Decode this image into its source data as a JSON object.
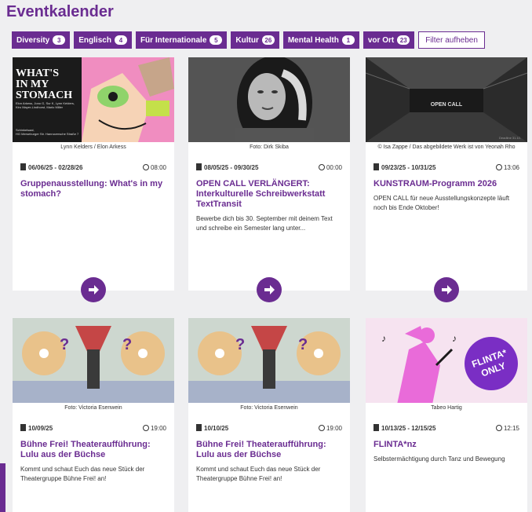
{
  "page": {
    "title": "Eventkalender"
  },
  "filters": [
    {
      "label": "Diversity",
      "count": "3"
    },
    {
      "label": "Englisch",
      "count": "4"
    },
    {
      "label": "Für Internationale",
      "count": "5"
    },
    {
      "label": "Kultur",
      "count": "26"
    },
    {
      "label": "Mental Health",
      "count": "1"
    },
    {
      "label": "vor Ort",
      "count": "23"
    }
  ],
  "reset_label": "Filter aufheben",
  "events": [
    {
      "credit": "Lynn Kelders / Elon Arkess",
      "date": "06/06/25 - 02/28/26",
      "time": "08:00",
      "title": "Gruppenausstellung: What's in my stomach?",
      "desc": "",
      "poster": {
        "line1": "WHAT'S",
        "line2": "IN MY",
        "line3": "STOMACH",
        "small1": "Elon Arkess, Jono G, Sur K, Lynn Kelders,",
        "small2": "Kiro Mayer-Lindhorst, Marlo Miller",
        "small3": "Schinkelsaal,",
        "small4": "HG Merseburger Str. Hannoversche Straße 7"
      }
    },
    {
      "credit": "Foto: Dirk Skiba",
      "date": "08/05/25 - 09/30/25",
      "time": "00:00",
      "title": "OPEN CALL VERLÄNGERT: Interkulturelle Schreibwerkstatt TextTransit",
      "desc": "Bewerbe dich bis 30. September mit deinem Text und schreibe ein Semester lang unter..."
    },
    {
      "credit": "© Isa Zappe / Das abgebildete Werk ist von Yeonah Rho",
      "date": "09/23/25 - 10/31/25",
      "time": "13:06",
      "title": "KUNSTRAUM-Programm 2026",
      "desc": "OPEN CALL für neue Ausstellungskonzepte läuft noch bis Ende Oktober!",
      "photo_text": "OPEN CALL",
      "photo_small": "Deadline 31.10."
    },
    {
      "credit": "Foto: Victoria Esenwein",
      "date": "10/09/25",
      "time": "19:00",
      "title": "Bühne Frei! Theateraufführung: Lulu aus der Büchse",
      "desc": "Kommt und schaut Euch das neue Stück der Theatergruppe Bühne Frei! an!"
    },
    {
      "credit": "Foto: Victoria Esenwein",
      "date": "10/10/25",
      "time": "19:00",
      "title": "Bühne Frei! Theateraufführung: Lulu aus der Büchse",
      "desc": "Kommt und schaut Euch das neue Stück der Theatergruppe Bühne Frei! an!"
    },
    {
      "credit": "Tabeo Hartig",
      "date": "10/13/25 - 12/15/25",
      "time": "12:15",
      "title": "FLINTA*nz",
      "desc": "Selbstermächtigung durch Tanz und Bewegung",
      "badge_line1": "FLINTA*",
      "badge_line2": "ONLY"
    }
  ],
  "colors": {
    "accent": "#6a2c91",
    "background": "#efeff1"
  }
}
